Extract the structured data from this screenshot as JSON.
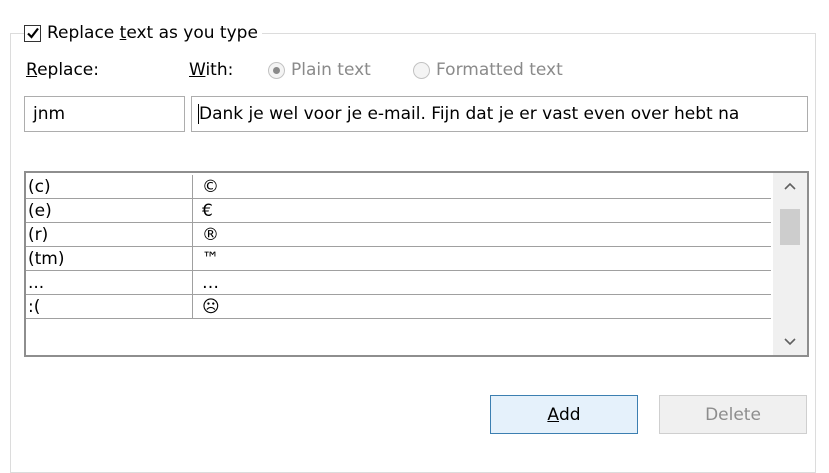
{
  "option": {
    "checkbox_checked": true,
    "label_before": "Replace ",
    "label_accel": "t",
    "label_after": "ext as you type"
  },
  "labels": {
    "replace_accel": "R",
    "replace_rest": "eplace:",
    "with_accel": "W",
    "with_rest": "ith:"
  },
  "radios": {
    "plain": "Plain text",
    "formatted": "Formatted text",
    "selected": "plain"
  },
  "inputs": {
    "replace_value": "jnm",
    "with_value": "Dank je wel voor je e-mail. Fijn dat je er vast even over hebt na"
  },
  "list": {
    "rows": [
      {
        "replace": "(c)",
        "with": "©"
      },
      {
        "replace": "(e)",
        "with": "€"
      },
      {
        "replace": "(r)",
        "with": "®"
      },
      {
        "replace": "(tm)",
        "with": "™"
      },
      {
        "replace": "...",
        "with": "…"
      },
      {
        "replace": ":(",
        "with": "☹"
      }
    ]
  },
  "buttons": {
    "add_accel": "A",
    "add_rest": "dd",
    "delete": "Delete"
  },
  "colors": {
    "accent_border": "#3c7fb1",
    "accent_fill": "#e5f1fb",
    "disabled_text": "#8d8d8d"
  }
}
